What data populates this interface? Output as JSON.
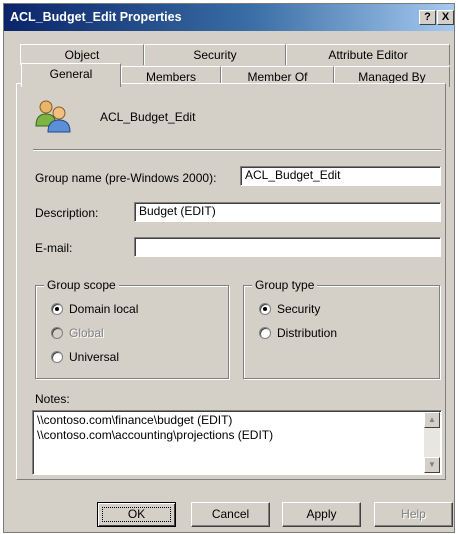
{
  "window": {
    "title": "ACL_Budget_Edit Properties"
  },
  "title_buttons": {
    "help": "?",
    "close": "X"
  },
  "tabs": {
    "row1": [
      {
        "label": "Object"
      },
      {
        "label": "Security"
      },
      {
        "label": "Attribute Editor"
      }
    ],
    "row2": [
      {
        "label": "General"
      },
      {
        "label": "Members"
      },
      {
        "label": "Member Of"
      },
      {
        "label": "Managed By"
      }
    ],
    "selected": "General"
  },
  "general": {
    "group_name": "ACL_Budget_Edit",
    "pre2000_label": "Group name (pre-Windows 2000):",
    "pre2000_value": "ACL_Budget_Edit",
    "description_label": "Description:",
    "description_value": "Budget (EDIT)",
    "email_label": "E-mail:",
    "email_value": "",
    "group_scope": {
      "label": "Group scope",
      "options": [
        {
          "label": "Domain local",
          "selected": true,
          "enabled": true
        },
        {
          "label": "Global",
          "selected": false,
          "enabled": false
        },
        {
          "label": "Universal",
          "selected": false,
          "enabled": true
        }
      ]
    },
    "group_type": {
      "label": "Group type",
      "options": [
        {
          "label": "Security",
          "selected": true
        },
        {
          "label": "Distribution",
          "selected": false
        }
      ]
    },
    "notes_label": "Notes:",
    "notes_lines": [
      "\\\\contoso.com\\finance\\budget (EDIT)",
      "\\\\contoso.com\\accounting\\projections (EDIT)"
    ]
  },
  "buttons": {
    "ok": "OK",
    "cancel": "Cancel",
    "apply": "Apply",
    "help": "Help"
  },
  "colors": {
    "titlebar_start": "#0a246a",
    "titlebar_end": "#a6caf0",
    "face": "#d4d0c8"
  },
  "icons": {
    "group": "group-users-icon",
    "scroll_up": "scroll-up-arrow-icon",
    "scroll_down": "scroll-down-arrow-icon"
  }
}
